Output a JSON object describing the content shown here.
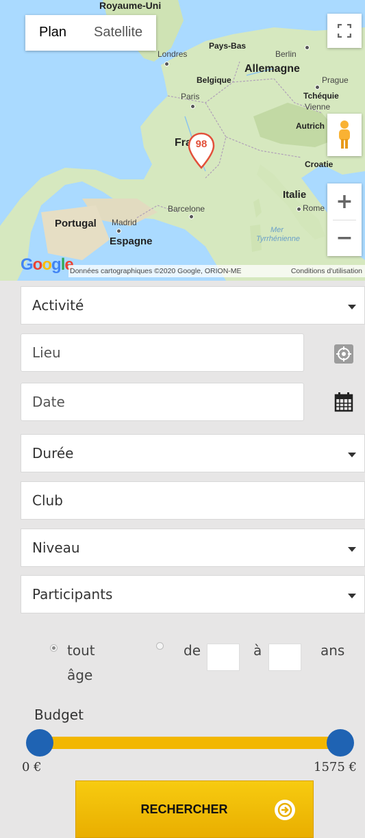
{
  "map": {
    "type_plan": "Plan",
    "type_satellite": "Satellite",
    "labels": {
      "top": "Royaume-Uni",
      "londres": "Londres",
      "pays_bas": "Pays-Bas",
      "berlin": "Berlin",
      "allemagne": "Allemagne",
      "belgique": "Belgique",
      "prague": "Prague",
      "paris": "Paris",
      "tchequie": "Tchéquie",
      "vienne": "Vienne",
      "autriche": "Autrich",
      "france": "Fra",
      "croatie": "Croatie",
      "italie": "Italie",
      "rome": "Rome",
      "barcelone": "Barcelone",
      "portugal": "Portugal",
      "madrid": "Madrid",
      "espagne": "Espagne",
      "mer": "Mer",
      "tyrrhenienne": "Tyrrhénienne"
    },
    "marker_count": "98",
    "google": "Google",
    "attribution": "Données cartographiques ©2020 Google, ORION-ME",
    "terms": "Conditions d'utilisation",
    "zoom_in": "+",
    "zoom_out": "−"
  },
  "form": {
    "activite": "Activité",
    "lieu_placeholder": "Lieu",
    "date_placeholder": "Date",
    "duree": "Durée",
    "club_placeholder": "Club",
    "niveau": "Niveau",
    "participants": "Participants",
    "age": {
      "tout": "tout",
      "age": "âge",
      "de": "de",
      "a": "à",
      "ans": "ans"
    },
    "budget": {
      "label": "Budget",
      "min": "0 €",
      "max": "1575 €"
    },
    "search_label": "RECHERCHER"
  },
  "colors": {
    "slider_track": "#f2b701",
    "slider_knob": "#1f63b3",
    "button": "#f4c20d",
    "marker": "#e2503a"
  }
}
